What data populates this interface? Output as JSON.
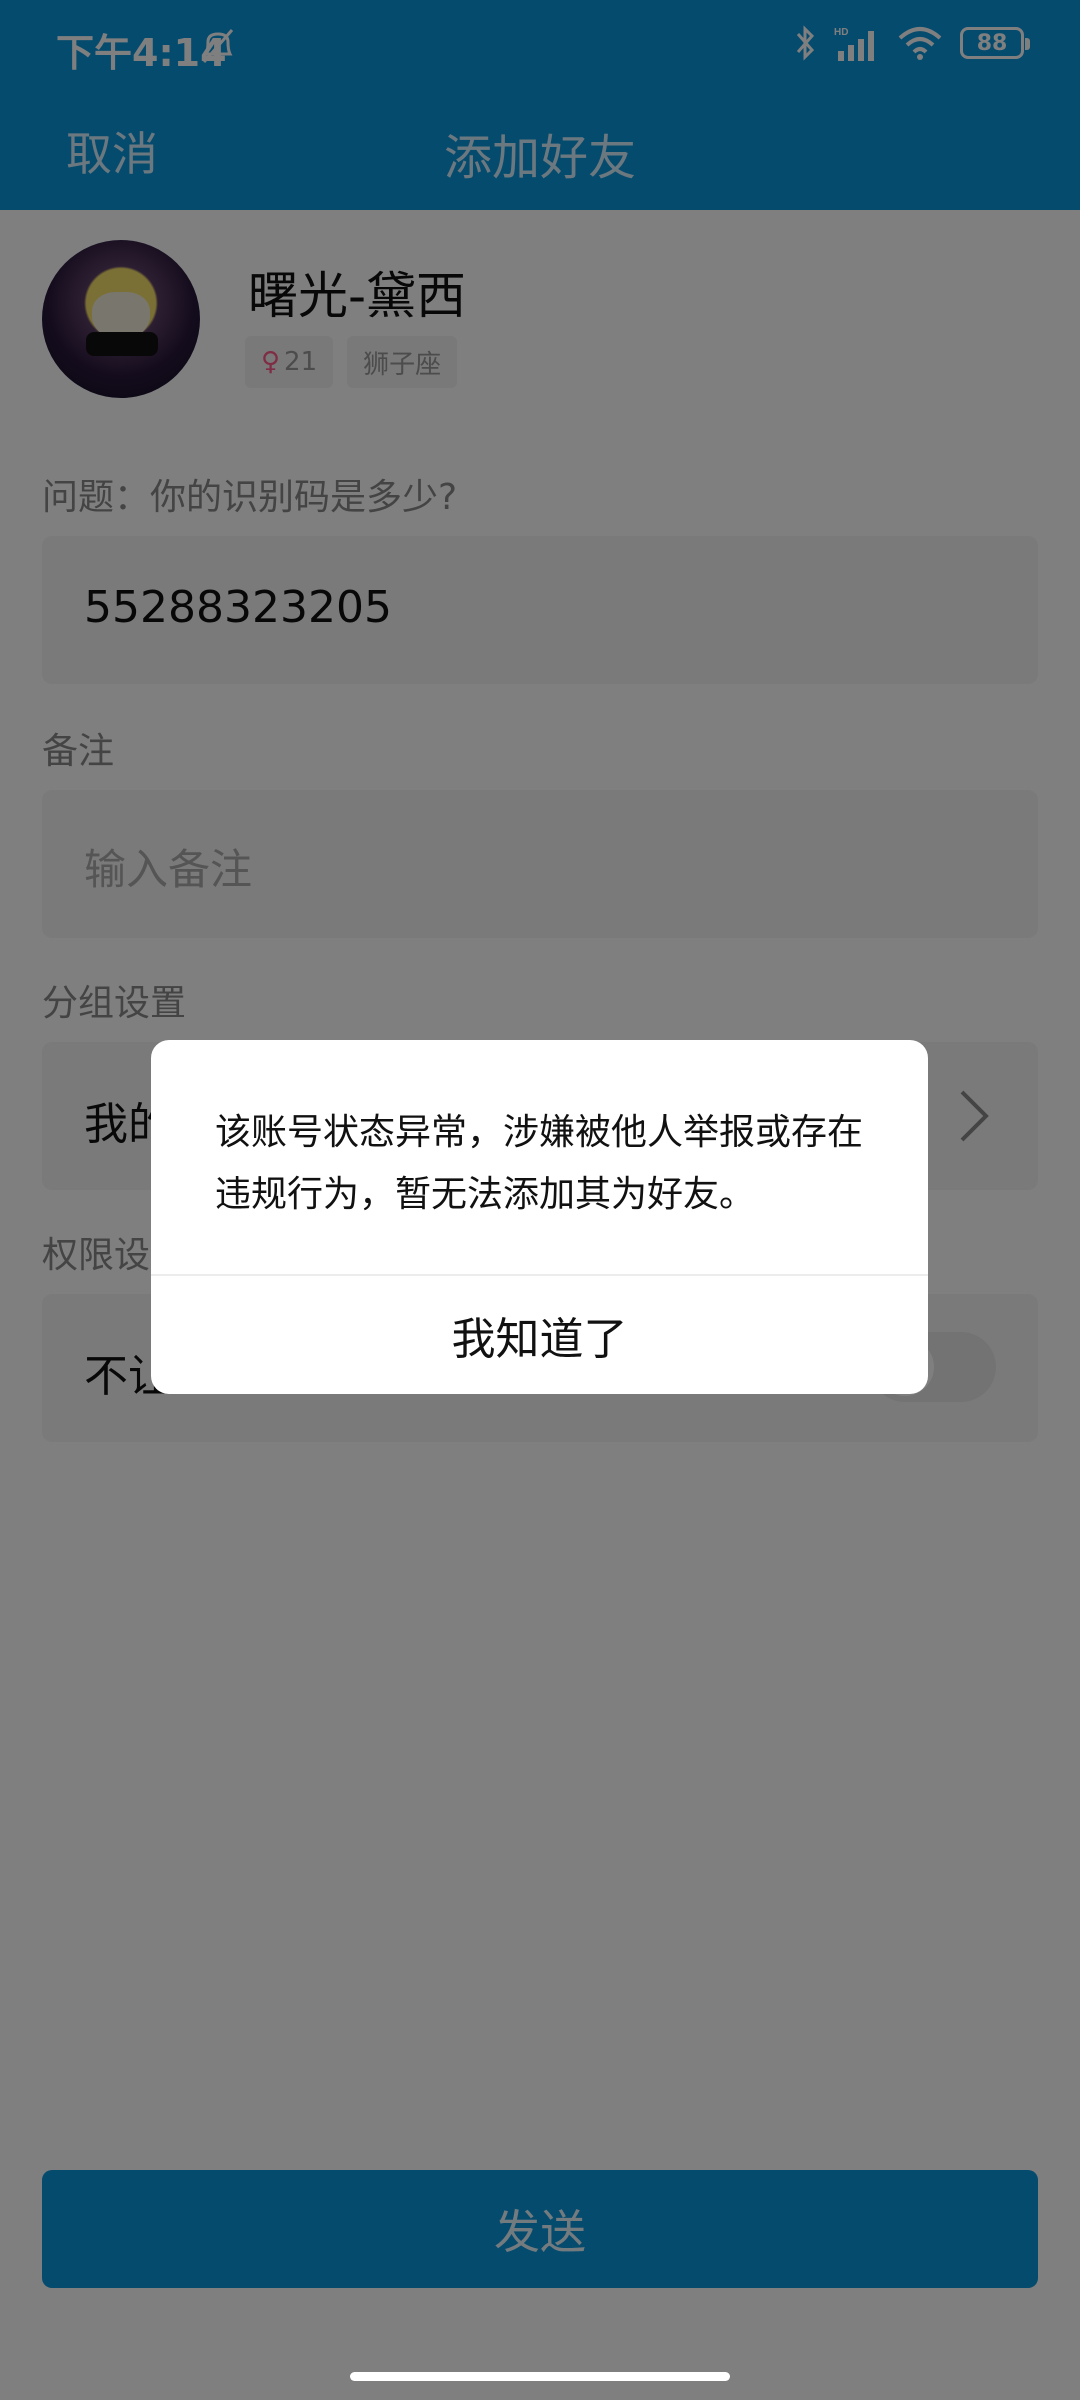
{
  "status_bar": {
    "time": "下午4:14",
    "battery": "88",
    "icons": [
      "bell-off-icon",
      "bluetooth-icon",
      "signal-hd-icon",
      "wifi-icon",
      "battery-icon"
    ]
  },
  "navbar": {
    "cancel_label": "取消",
    "title": "添加好友"
  },
  "profile": {
    "nickname": "曙光-黛西",
    "gender_symbol": "♀",
    "age": "21",
    "zodiac": "狮子座"
  },
  "question": {
    "label": "问题：你的识别码是多少?",
    "answer": "55288323205"
  },
  "remark": {
    "label": "备注",
    "placeholder": "输入备注"
  },
  "group": {
    "label": "分组设置",
    "value": "我的"
  },
  "permission": {
    "label": "权限设",
    "value": "不让"
  },
  "send_label": "发送",
  "dialog": {
    "message": "该账号状态异常，涉嫌被他人举报或存在违规行为，暂无法添加其为好友。",
    "ok_label": "我知道了"
  },
  "colors": {
    "brand": "#0a96dd",
    "overlay": "rgba(0,0,0,0.5)"
  }
}
